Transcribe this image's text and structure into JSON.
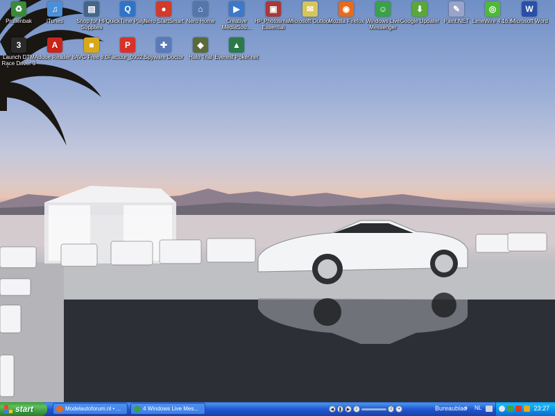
{
  "desktop": {
    "icons": [
      {
        "label": "Prullenbak",
        "icon": "recycle-bin-icon",
        "color": "#3a8a3a",
        "glyph": "♻"
      },
      {
        "label": "iTunes",
        "icon": "itunes-icon",
        "color": "#4a8fd8",
        "glyph": "♫"
      },
      {
        "label": "Shop for HP Supplies",
        "icon": "hp-shop-icon",
        "color": "#446688",
        "glyph": "▤"
      },
      {
        "label": "QuickTime Player",
        "icon": "quicktime-icon",
        "color": "#2f74c8",
        "glyph": "Q"
      },
      {
        "label": "Nero StartSmart",
        "icon": "nero-startsmart-icon",
        "color": "#d23a2a",
        "glyph": "●"
      },
      {
        "label": "Nero Home",
        "icon": "nero-home-icon",
        "color": "#5576aa",
        "glyph": "⌂"
      },
      {
        "label": "Creative MediaSou...",
        "icon": "creative-mediasource-icon",
        "color": "#3d79c9",
        "glyph": "▶"
      },
      {
        "label": "HP Photosmart Essential",
        "icon": "hp-photosmart-icon",
        "color": "#a83a3a",
        "glyph": "▣"
      },
      {
        "label": "Microsoft Outlook",
        "icon": "outlook-icon",
        "color": "#d6c65a",
        "glyph": "✉"
      },
      {
        "label": "Mozilla Firefox",
        "icon": "firefox-icon",
        "color": "#e86a1c",
        "glyph": "◉"
      },
      {
        "label": "Windows Live Messenger",
        "icon": "messenger-icon",
        "color": "#3aa04a",
        "glyph": "☺"
      },
      {
        "label": "Google Updater",
        "icon": "google-updater-icon",
        "color": "#5aa83a",
        "glyph": "⬇"
      },
      {
        "label": "Paint.NET",
        "icon": "paintnet-icon",
        "color": "#9aa3c8",
        "glyph": "✎"
      },
      {
        "label": "LimeWire 4.16.6",
        "icon": "limewire-icon",
        "color": "#4fb83a",
        "glyph": "◎"
      },
      {
        "label": "Microsoft Word",
        "icon": "word-icon",
        "color": "#2a4fa8",
        "glyph": "W"
      },
      {
        "label": "Launch DTM Race Driver 3",
        "icon": "dtm-race-driver-icon",
        "color": "#2a2a2a",
        "glyph": "3"
      },
      {
        "label": "Adobe Reader 8",
        "icon": "adobe-reader-icon",
        "color": "#c8241c",
        "glyph": "A"
      },
      {
        "label": "AVG Free 8.0",
        "icon": "avg-icon",
        "color": "#d8a81c",
        "glyph": "■"
      },
      {
        "label": "Factuur_0902...",
        "icon": "pdf-file-icon",
        "color": "#d8322a",
        "glyph": "P"
      },
      {
        "label": "Spyware Doctor",
        "icon": "spyware-doctor-icon",
        "color": "#5a7ab8",
        "glyph": "✚"
      },
      {
        "label": "Halo Trial",
        "icon": "halo-icon",
        "color": "#5a6a3a",
        "glyph": "◆"
      },
      {
        "label": "Everest Poker.net",
        "icon": "everest-poker-icon",
        "color": "#2a7a4a",
        "glyph": "▲"
      }
    ]
  },
  "taskbar": {
    "start_label": "start",
    "tasks": [
      {
        "label": "Modelautoforum.nl • ...",
        "icon": "firefox-icon",
        "color": "#e86a1c"
      },
      {
        "label": "4 Windows Live Mes...",
        "icon": "messenger-icon",
        "color": "#3aa04a"
      }
    ],
    "toolbar_label": "Bureaublad",
    "language": "NL",
    "clock": "23:27"
  },
  "colors": {
    "taskbar": "#245edb",
    "start": "#3c9a3c",
    "tray": "#0f8fe6"
  }
}
